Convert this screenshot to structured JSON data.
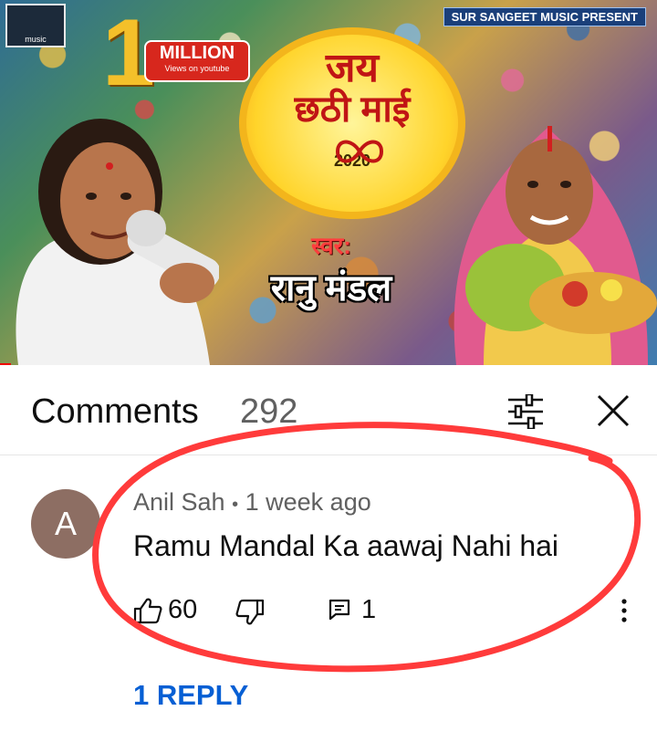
{
  "thumbnail": {
    "channel_logo_text": "music",
    "presenter": "SUR SANGEET MUSIC PRESENT",
    "badge_number": "1",
    "badge_text": "MILLION",
    "badge_subtext": "Views on youtube",
    "title_line1": "जय",
    "title_line2": "छठी माई",
    "year": "2020",
    "singer_prefix": "स्वर:",
    "singer_name": "रानु मंडल",
    "progress_fraction": 0.017
  },
  "comments_panel": {
    "title": "Comments",
    "count": "292",
    "sort_icon": "sort-filter-icon",
    "close_icon": "close-icon"
  },
  "comment": {
    "avatar_letter": "A",
    "avatar_color": "#8d6e63",
    "author": "Anil Sah",
    "separator": "•",
    "time": "1 week ago",
    "text": "Ramu Mandal Ka aawaj Nahi hai",
    "likes": "60",
    "replies_count": "1",
    "replies_link": "1 REPLY"
  },
  "colors": {
    "link_blue": "#065fd4",
    "annotation_red": "#ff3b3b",
    "secondary_text": "#606060"
  }
}
